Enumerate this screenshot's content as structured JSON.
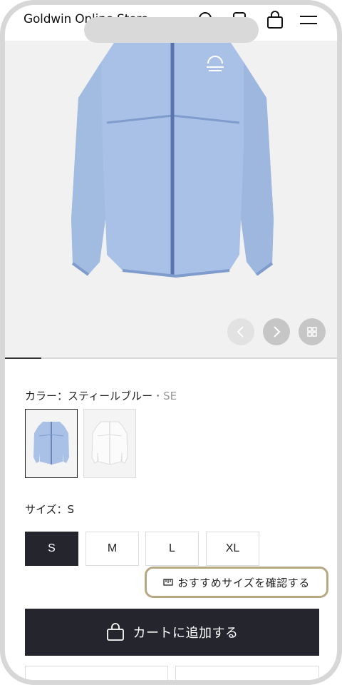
{
  "header": {
    "store_name": "Goldwin Online Store",
    "icons": [
      "search-icon",
      "account-icon",
      "shopping-bag-icon",
      "hamburger-menu-icon"
    ]
  },
  "gallery": {
    "product_image": "blue-windbreaker-jacket",
    "progress": 0.11,
    "buttons": [
      "chevron-left-icon",
      "chevron-right-icon",
      "grid-icon"
    ]
  },
  "color": {
    "label": "カラー：スティールブルー",
    "code": "・SE",
    "swatches": [
      "steel-blue",
      "white"
    ]
  },
  "size": {
    "label": "サイズ：S",
    "options": [
      "S",
      "M",
      "L",
      "XL"
    ],
    "selected": "S"
  },
  "recommend": {
    "label": "おすすめサイズを確認する"
  },
  "cart": {
    "label": "カートに追加する"
  },
  "colors": {
    "accent_dark": "#25252e",
    "recommend_border": "#b5a883",
    "jacket_blue": "#a9c1e6"
  }
}
